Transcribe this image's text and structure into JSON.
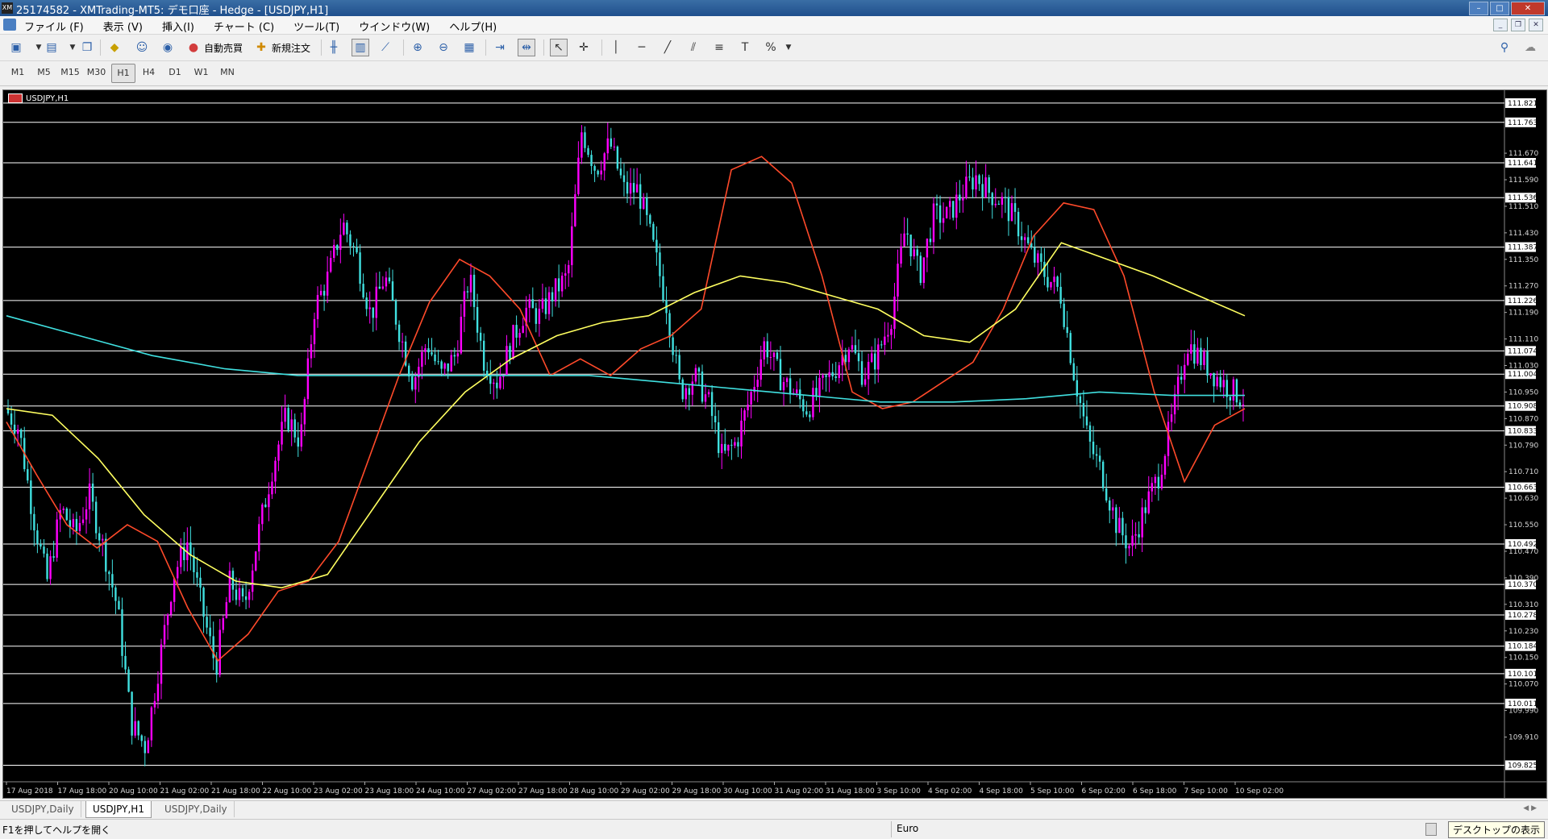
{
  "window": {
    "title": "25174582 - XMTrading-MT5: デモ口座 - Hedge - [USDJPY,H1]",
    "logo_text": "XM",
    "buttons": [
      "minimize",
      "maximize",
      "close"
    ]
  },
  "menu": {
    "items": [
      "ファイル (F)",
      "表示 (V)",
      "挿入(I)",
      "チャート (C)",
      "ツール(T)",
      "ウインドウ(W)",
      "ヘルプ(H)"
    ]
  },
  "toolbar": {
    "auto_trade_label": "自動売買",
    "new_order_label": "新規注文"
  },
  "timeframes": {
    "items": [
      "M1",
      "M5",
      "M15",
      "M30",
      "H1",
      "H4",
      "D1",
      "W1",
      "MN"
    ],
    "selected": "H1"
  },
  "chart": {
    "symbol_label": "USDJPY,H1",
    "colors": {
      "bull": "#ff00ff",
      "bear": "#40e0e0",
      "ma_red": "#ff4a2a",
      "ma_yellow": "#ffff60",
      "ma_cyan": "#40e0e0",
      "hline": "#ffffff"
    }
  },
  "chart_data": {
    "type": "candlestick",
    "symbol": "USDJPY",
    "timeframe": "H1",
    "ylim": [
      109.78,
      111.85
    ],
    "x_tick_labels": [
      "17 Aug 2018",
      "17 Aug 18:00",
      "20 Aug 10:00",
      "21 Aug 02:00",
      "21 Aug 18:00",
      "22 Aug 10:00",
      "23 Aug 02:00",
      "23 Aug 18:00",
      "24 Aug 10:00",
      "27 Aug 02:00",
      "27 Aug 18:00",
      "28 Aug 10:00",
      "29 Aug 02:00",
      "29 Aug 18:00",
      "30 Aug 10:00",
      "31 Aug 02:00",
      "31 Aug 18:00",
      "3 Sep 10:00",
      "4 Sep 02:00",
      "4 Sep 18:00",
      "5 Sep 10:00",
      "6 Sep 02:00",
      "6 Sep 18:00",
      "7 Sep 10:00",
      "10 Sep 02:00"
    ],
    "y_tick_labels": [
      "111.670",
      "111.590",
      "111.510",
      "111.430",
      "111.350",
      "111.270",
      "111.190",
      "111.110",
      "111.030",
      "110.950",
      "110.870",
      "110.790",
      "110.710",
      "110.630",
      "110.550",
      "110.470",
      "110.390",
      "110.310",
      "110.230",
      "110.150",
      "110.070",
      "109.990",
      "109.910"
    ],
    "horizontal_levels": [
      "111.821",
      "111.763",
      "111.641",
      "111.536",
      "111.387",
      "111.226",
      "111.074",
      "111.004",
      "110.908",
      "110.833",
      "110.663",
      "110.492",
      "110.370",
      "110.278",
      "110.184",
      "110.101",
      "110.011",
      "109.825"
    ],
    "close_path": [
      [
        0,
        110.9
      ],
      [
        1,
        110.84
      ],
      [
        2,
        110.58
      ],
      [
        3,
        110.38
      ],
      [
        4,
        110.6
      ],
      [
        5,
        110.52
      ],
      [
        6,
        110.64
      ],
      [
        7,
        110.48
      ],
      [
        8,
        110.3
      ],
      [
        9,
        109.95
      ],
      [
        10,
        109.88
      ],
      [
        11,
        110.14
      ],
      [
        12,
        110.4
      ],
      [
        13,
        110.5
      ],
      [
        14,
        110.3
      ],
      [
        15,
        110.12
      ],
      [
        16,
        110.38
      ],
      [
        17,
        110.3
      ],
      [
        18,
        110.52
      ],
      [
        19,
        110.72
      ],
      [
        20,
        110.88
      ],
      [
        21,
        110.8
      ],
      [
        22,
        111.2
      ],
      [
        23,
        111.3
      ],
      [
        24,
        111.46
      ],
      [
        25,
        111.36
      ],
      [
        26,
        111.18
      ],
      [
        27,
        111.3
      ],
      [
        28,
        111.14
      ],
      [
        29,
        110.98
      ],
      [
        30,
        111.1
      ],
      [
        31,
        111.0
      ],
      [
        32,
        111.06
      ],
      [
        33,
        111.3
      ],
      [
        34,
        111.05
      ],
      [
        35,
        110.98
      ],
      [
        36,
        111.1
      ],
      [
        37,
        111.2
      ],
      [
        38,
        111.18
      ],
      [
        39,
        111.25
      ],
      [
        40,
        111.3
      ],
      [
        41,
        111.74
      ],
      [
        42,
        111.62
      ],
      [
        43,
        111.7
      ],
      [
        44,
        111.56
      ],
      [
        45,
        111.56
      ],
      [
        46,
        111.4
      ],
      [
        47,
        111.22
      ],
      [
        48,
        110.95
      ],
      [
        49,
        111.0
      ],
      [
        50,
        110.92
      ],
      [
        51,
        110.75
      ],
      [
        52,
        110.8
      ],
      [
        53,
        110.94
      ],
      [
        54,
        111.1
      ],
      [
        55,
        111.0
      ],
      [
        56,
        110.95
      ],
      [
        57,
        110.9
      ],
      [
        58,
        110.96
      ],
      [
        59,
        111.02
      ],
      [
        60,
        111.1
      ],
      [
        61,
        111.0
      ],
      [
        62,
        111.06
      ],
      [
        63,
        111.18
      ],
      [
        64,
        111.45
      ],
      [
        65,
        111.3
      ],
      [
        66,
        111.48
      ],
      [
        67,
        111.48
      ],
      [
        68,
        111.55
      ],
      [
        69,
        111.6
      ],
      [
        70,
        111.55
      ],
      [
        71,
        111.52
      ],
      [
        72,
        111.45
      ],
      [
        73,
        111.36
      ],
      [
        74,
        111.3
      ],
      [
        75,
        111.25
      ],
      [
        76,
        111.0
      ],
      [
        77,
        110.8
      ],
      [
        78,
        110.7
      ],
      [
        79,
        110.55
      ],
      [
        80,
        110.48
      ],
      [
        81,
        110.6
      ],
      [
        82,
        110.7
      ],
      [
        83,
        110.88
      ],
      [
        84,
        111.1
      ],
      [
        85,
        111.05
      ],
      [
        86,
        111.0
      ],
      [
        87,
        110.96
      ],
      [
        88,
        110.93
      ]
    ],
    "series": [
      {
        "name": "",
        "color": "#ff4a2a",
        "values": [
          110.86,
          110.7,
          110.55,
          110.48,
          110.55,
          110.5,
          110.3,
          110.14,
          110.22,
          110.35,
          110.38,
          110.5,
          110.75,
          111.0,
          111.22,
          111.35,
          111.3,
          111.2,
          111.0,
          111.05,
          111.0,
          111.08,
          111.12,
          111.2,
          111.62,
          111.66,
          111.58,
          111.3,
          110.95,
          110.9,
          110.92,
          110.98,
          111.04,
          111.2,
          111.42,
          111.52,
          111.5,
          111.3,
          110.95,
          110.68,
          110.85,
          110.9
        ]
      },
      {
        "name": "",
        "color": "#ffff60",
        "values": [
          110.9,
          110.88,
          110.75,
          110.58,
          110.46,
          110.38,
          110.36,
          110.4,
          110.6,
          110.8,
          110.95,
          111.05,
          111.12,
          111.16,
          111.18,
          111.25,
          111.3,
          111.28,
          111.24,
          111.2,
          111.12,
          111.1,
          111.2,
          111.4,
          111.35,
          111.3,
          111.24,
          111.18
        ]
      },
      {
        "name": "",
        "color": "#40e0e0",
        "values": [
          111.18,
          111.12,
          111.06,
          111.02,
          111.0,
          111.0,
          111.0,
          111.0,
          111.0,
          110.98,
          110.96,
          110.94,
          110.92,
          110.92,
          110.93,
          110.95,
          110.94,
          110.94
        ]
      }
    ]
  },
  "tabs": {
    "items": [
      "USDJPY,Daily",
      "USDJPY,H1",
      "USDJPY,Daily"
    ],
    "active_index": 1
  },
  "status": {
    "help_text": "F1を押してヘルプを開く",
    "profile": "Euro",
    "tooltip": "デスクトップの表示"
  }
}
